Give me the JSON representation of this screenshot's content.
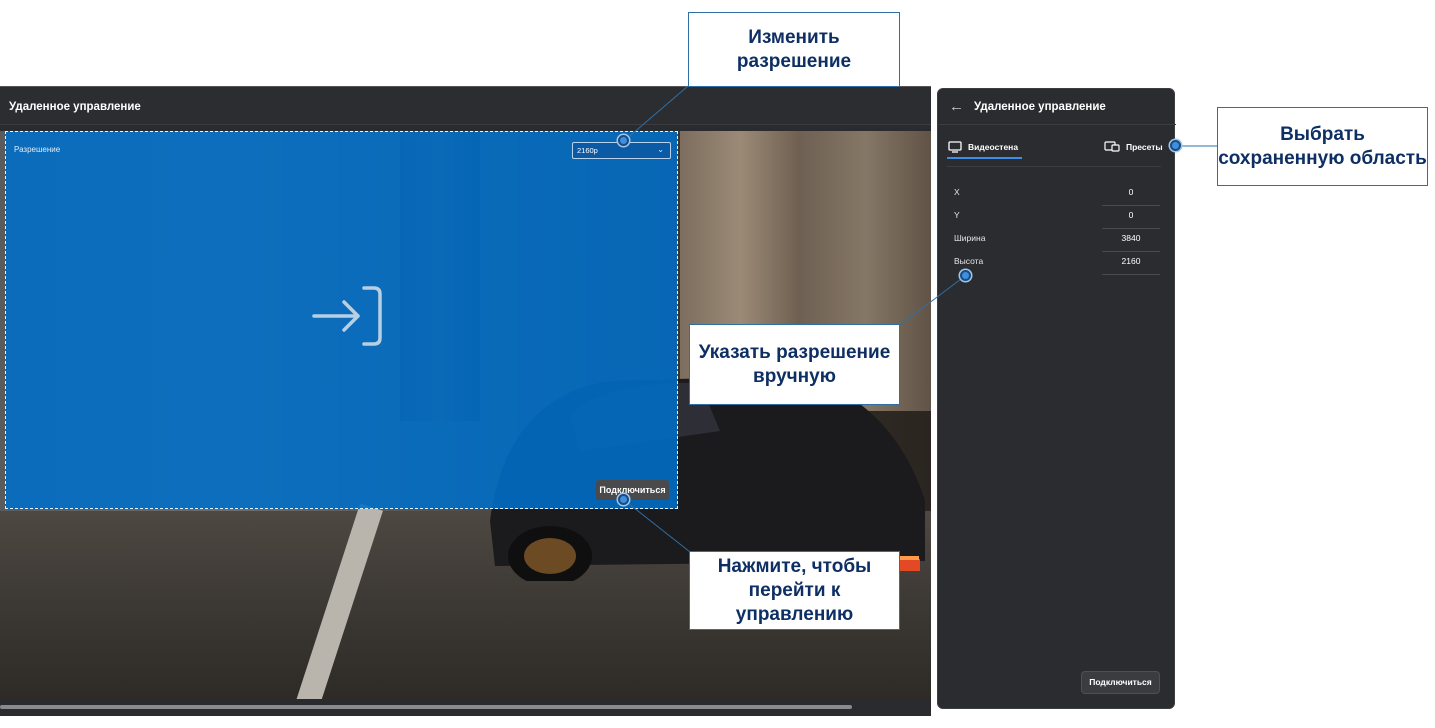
{
  "main": {
    "title": "Удаленное управление"
  },
  "selection": {
    "resolution_label": "Разрешение",
    "resolution_value": "2160p",
    "connect_label": "Подключиться",
    "enter_icon": "enter-arrow-icon"
  },
  "side": {
    "title": "Удаленное управление",
    "tabs": [
      {
        "label": "Видеостена",
        "icon": "monitor-icon",
        "active": true
      },
      {
        "label": "Пресеты",
        "icon": "presets-icon",
        "active": false
      }
    ],
    "fields": [
      {
        "label": "X",
        "value": "0"
      },
      {
        "label": "Y",
        "value": "0"
      },
      {
        "label": "Ширина",
        "value": "3840"
      },
      {
        "label": "Высота",
        "value": "2160"
      }
    ],
    "connect_label": "Подключиться"
  },
  "callouts": {
    "change_resolution": "Изменить разрешение",
    "choose_saved_area": "Выбрать сохраненную область",
    "manual_resolution": "Указать разрешение вручную",
    "press_to_control": "Нажмите, чтобы перейти к управлению"
  },
  "colors": {
    "accent": "#3a8eea",
    "selection": "#0068c8",
    "callout_text": "#0e2f63"
  }
}
